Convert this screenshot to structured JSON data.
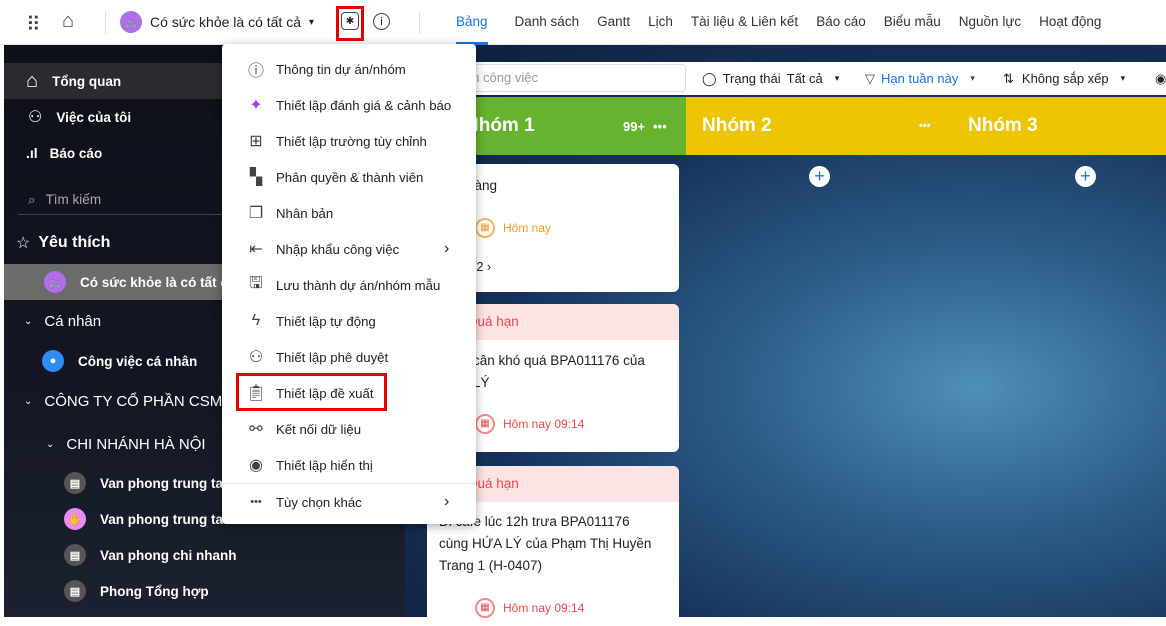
{
  "header": {
    "project_name": "Có sức khỏe là có tất cả",
    "tabs": [
      "Bảng",
      "Danh sách",
      "Gantt",
      "Lịch",
      "Tài liệu & Liên kết",
      "Báo cáo",
      "Biểu mẫu",
      "Nguồn lực",
      "Hoạt động"
    ]
  },
  "sidebar": {
    "overview": "Tổng quan",
    "my_tasks": "Việc của tôi",
    "reports": "Báo cáo",
    "search_placeholder": "Tìm kiếm",
    "favorites": "Yêu thích",
    "fav_project": "Có sức khỏe là có tất cả",
    "personal": "Cá nhân",
    "personal_tasks": "Công việc cá nhân",
    "company": "CÔNG TY CỔ PHẦN CSM",
    "branch": "CHI NHÁNH HÀ NỘI",
    "offices": [
      "Van phong trung ta",
      "Van phong trung ta",
      "Van phong chi nhanh",
      "Phong Tổng hợp"
    ]
  },
  "filter": {
    "search_placeholder": "Tìm kiếm công việc",
    "status_label": "Trạng thái",
    "status_value": "Tất cả",
    "deadline": "Hạn tuần này",
    "sort": "Không sắp xếp"
  },
  "columns": [
    {
      "name": "Nhóm 1",
      "count": "99+",
      "color": "#65b32e"
    },
    {
      "name": "Nhóm 2",
      "color": "#ecc400"
    },
    {
      "name": "Nhóm 3",
      "color": "#ecc400"
    }
  ],
  "cards": [
    {
      "title": "hàng",
      "due": "Hôm nay",
      "subtasks": "/2"
    },
    {
      "status": "Quá hạn",
      "title_l1": "cân khó quá BPA011176 của",
      "title_l2": "LÝ",
      "due": "Hôm nay 09:14"
    },
    {
      "status": "Quá hạn",
      "title_l1": "Đi cafe lúc 12h trưa BPA011176",
      "title_l2": "cùng HỨA LÝ của Phạm Thị Huyền",
      "title_l3": "Trang 1 (H-0407)",
      "due": "Hôm nay 09:14"
    }
  ],
  "menu": {
    "items": [
      "Thông tin dự án/nhóm",
      "Thiết lập đánh giá & cảnh báo",
      "Thiết lập trường tùy chỉnh",
      "Phân quyền & thành viên",
      "Nhân bản",
      "Nhập khẩu công việc",
      "Lưu thành dự án/nhóm mẫu",
      "Thiết lập tự động",
      "Thiết lập phê duyệt",
      "Thiết lập đề xuất",
      "Kết nối dữ liệu",
      "Thiết lập hiển thị"
    ],
    "more": "Tùy chọn khác"
  }
}
